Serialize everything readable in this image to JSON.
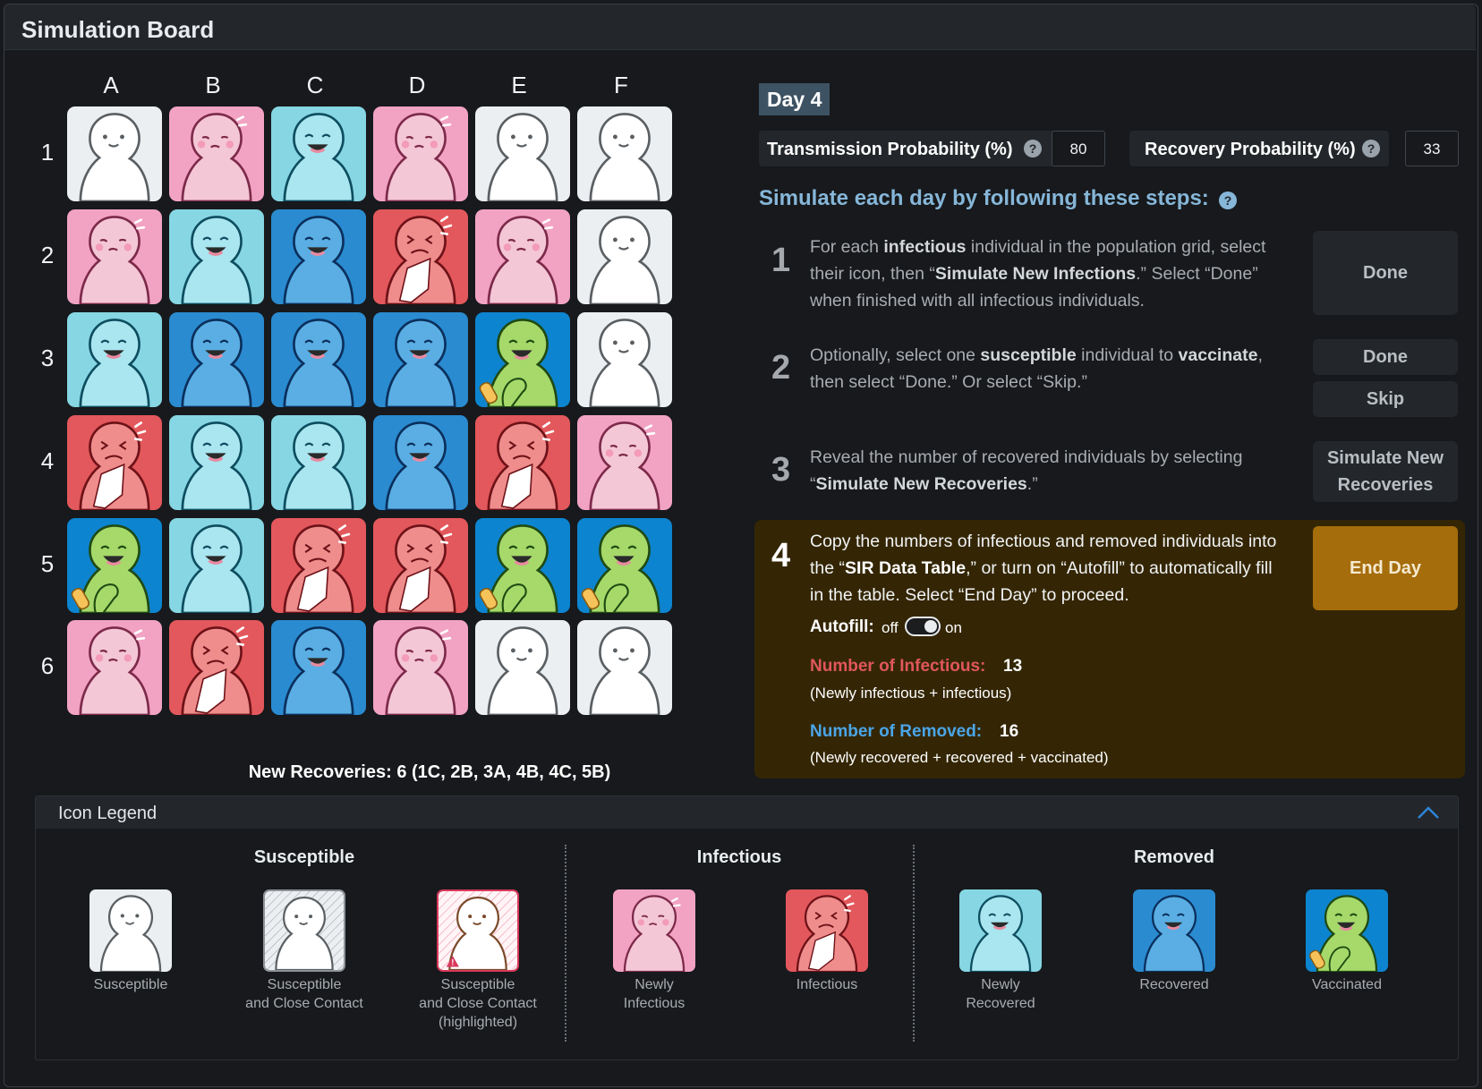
{
  "app": {
    "title": "Simulation Board"
  },
  "grid": {
    "columns": [
      "A",
      "B",
      "C",
      "D",
      "E",
      "F"
    ],
    "rows": [
      "1",
      "2",
      "3",
      "4",
      "5",
      "6"
    ],
    "cells": [
      [
        "susceptible",
        "newly-infectious",
        "newly-recovered",
        "newly-infectious",
        "susceptible",
        "susceptible"
      ],
      [
        "newly-infectious",
        "newly-recovered",
        "recovered",
        "infectious",
        "newly-infectious",
        "susceptible"
      ],
      [
        "newly-recovered",
        "recovered",
        "recovered",
        "recovered",
        "vaccinated",
        "susceptible"
      ],
      [
        "infectious",
        "newly-recovered",
        "newly-recovered",
        "recovered",
        "infectious",
        "newly-infectious"
      ],
      [
        "vaccinated",
        "newly-recovered",
        "infectious",
        "infectious",
        "vaccinated",
        "vaccinated"
      ],
      [
        "newly-infectious",
        "infectious",
        "recovered",
        "newly-infectious",
        "susceptible",
        "susceptible"
      ]
    ],
    "new_recoveries": "New Recoveries: 6 (1C, 2B, 3A, 4B, 4C, 5B)"
  },
  "panel": {
    "day": "Day 4",
    "transmission_label": "Transmission Probability (%)",
    "transmission_value": "80",
    "recovery_label": "Recovery Probability (%)",
    "recovery_value": "33",
    "help_glyph": "?",
    "steps_heading": "Simulate each day by following these steps:",
    "steps": {
      "s1": {
        "num": "1",
        "button": "Done"
      },
      "s2": {
        "num": "2",
        "button_done": "Done",
        "button_skip": "Skip"
      },
      "s3": {
        "num": "3",
        "button": "Simulate New Recoveries"
      },
      "s4": {
        "num": "4",
        "button": "End Day",
        "autofill_label": "Autofill:",
        "autofill_off": "off",
        "autofill_on": "on",
        "autofill_state": "on",
        "infectious_label": "Number of Infectious:",
        "infectious_value": "13",
        "infectious_note": "(Newly infectious + infectious)",
        "removed_label": "Number of Removed:",
        "removed_value": "16",
        "removed_note": "(Newly recovered + recovered + vaccinated)"
      }
    }
  },
  "legend": {
    "title": "Icon Legend",
    "groups": {
      "susceptible": "Susceptible",
      "infectious": "Infectious",
      "removed": "Removed"
    },
    "items": [
      {
        "type": "susceptible",
        "label": "Susceptible"
      },
      {
        "type": "close-contact",
        "label": "Susceptible\nand Close Contact"
      },
      {
        "type": "close-contact-highlighted",
        "label": "Susceptible\nand Close Contact\n(highlighted)"
      },
      {
        "type": "newly-infectious",
        "label": "Newly\nInfectious"
      },
      {
        "type": "infectious",
        "label": "Infectious"
      },
      {
        "type": "newly-recovered",
        "label": "Newly\nRecovered"
      },
      {
        "type": "recovered",
        "label": "Recovered"
      },
      {
        "type": "vaccinated",
        "label": "Vaccinated"
      }
    ]
  },
  "colors": {
    "susceptible": "#eceff1",
    "newly_infectious": "#f2a3c3",
    "infectious": "#e3585c",
    "newly_recovered": "#86d6e3",
    "recovered": "#2a8bd0",
    "vaccinated": "#0d84cf",
    "infectious_text": "#e0575b",
    "removed_text": "#4aa6e8",
    "end_day": "#a66d0c"
  }
}
